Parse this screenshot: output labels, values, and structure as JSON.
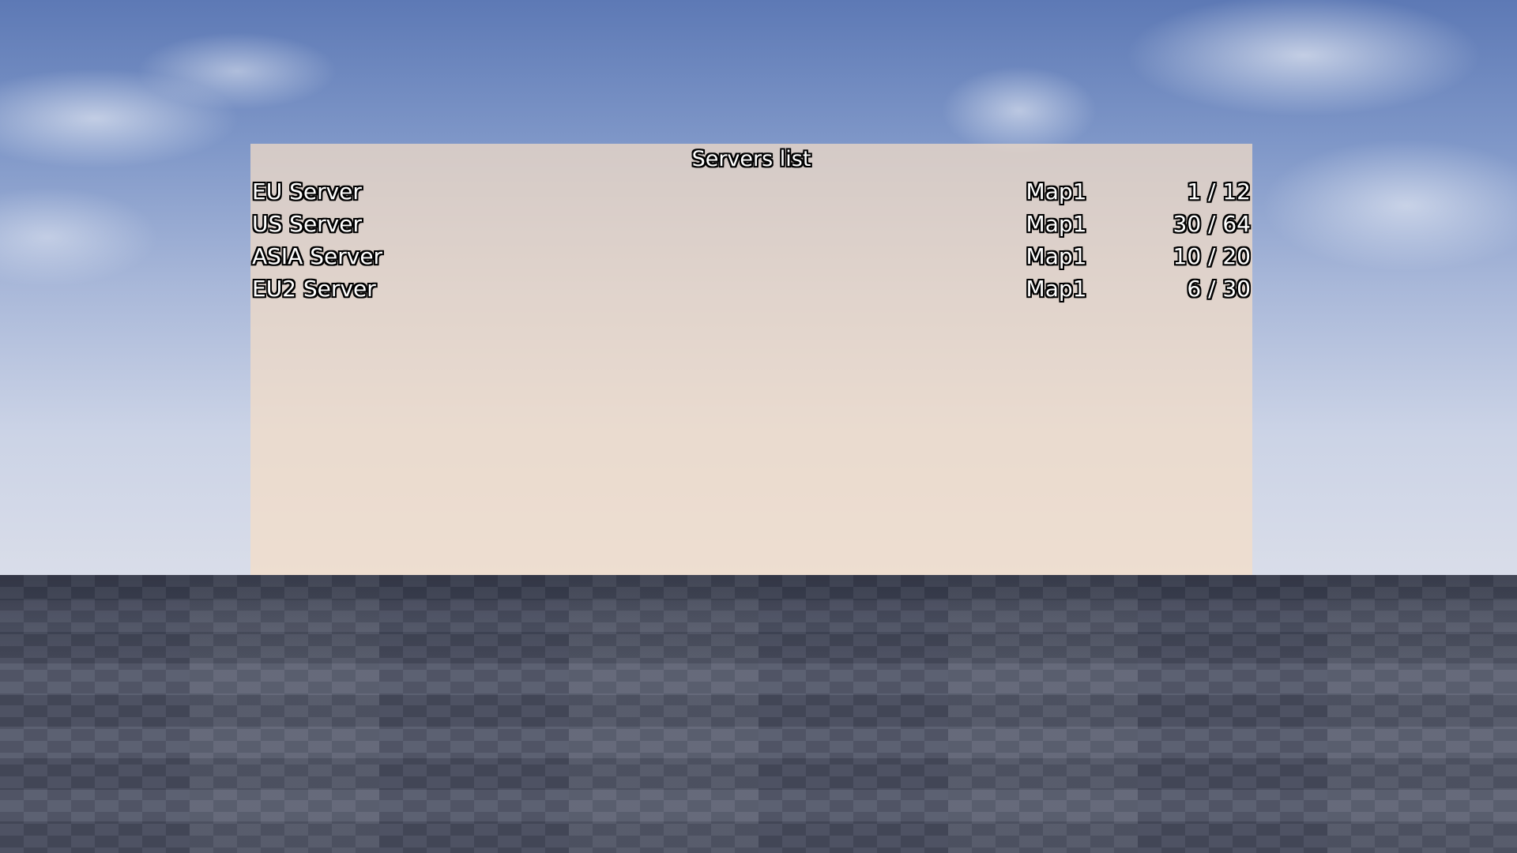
{
  "panel": {
    "title": "Servers list"
  },
  "servers": [
    {
      "name": "EU Server",
      "map": "Map1",
      "players": "1 / 12"
    },
    {
      "name": "US Server",
      "map": "Map1",
      "players": "30 / 64"
    },
    {
      "name": "ASIA Server",
      "map": "Map1",
      "players": "10 / 20"
    },
    {
      "name": "EU2 Server",
      "map": "Map1",
      "players": "6 / 30"
    }
  ]
}
